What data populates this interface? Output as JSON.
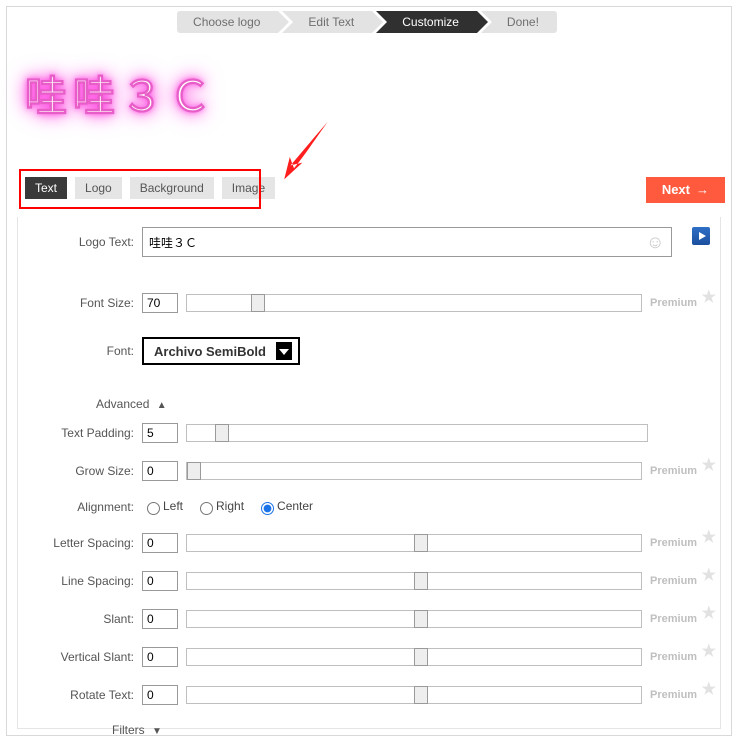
{
  "wizard": {
    "steps": [
      "Choose logo",
      "Edit Text",
      "Customize",
      "Done!"
    ],
    "active_index": 2
  },
  "logo_preview_text": "哇哇３Ｃ",
  "tabs": {
    "items": [
      "Text",
      "Logo",
      "Background",
      "Image"
    ],
    "active_index": 0
  },
  "next_button_label": "Next",
  "form": {
    "logo_text": {
      "label": "Logo Text:",
      "value": "哇哇３Ｃ"
    },
    "font_size": {
      "label": "Font Size:",
      "value": "70",
      "slider_pct": 14,
      "premium": "Premium"
    },
    "font": {
      "label": "Font:",
      "value": "Archivo SemiBold"
    },
    "advanced_label": "Advanced",
    "text_padding": {
      "label": "Text Padding:",
      "value": "5",
      "slider_pct": 6
    },
    "grow_size": {
      "label": "Grow Size:",
      "value": "0",
      "slider_pct": 0,
      "premium": "Premium"
    },
    "alignment": {
      "label": "Alignment:",
      "options": [
        "Left",
        "Right",
        "Center"
      ],
      "selected": "Center"
    },
    "letter_spacing": {
      "label": "Letter Spacing:",
      "value": "0",
      "slider_pct": 50,
      "premium": "Premium"
    },
    "line_spacing": {
      "label": "Line Spacing:",
      "value": "0",
      "slider_pct": 50,
      "premium": "Premium"
    },
    "slant": {
      "label": "Slant:",
      "value": "0",
      "slider_pct": 50,
      "premium": "Premium"
    },
    "vertical_slant": {
      "label": "Vertical Slant:",
      "value": "0",
      "slider_pct": 50,
      "premium": "Premium"
    },
    "rotate_text": {
      "label": "Rotate Text:",
      "value": "0",
      "slider_pct": 50,
      "premium": "Premium"
    },
    "filters_label": "Filters"
  }
}
